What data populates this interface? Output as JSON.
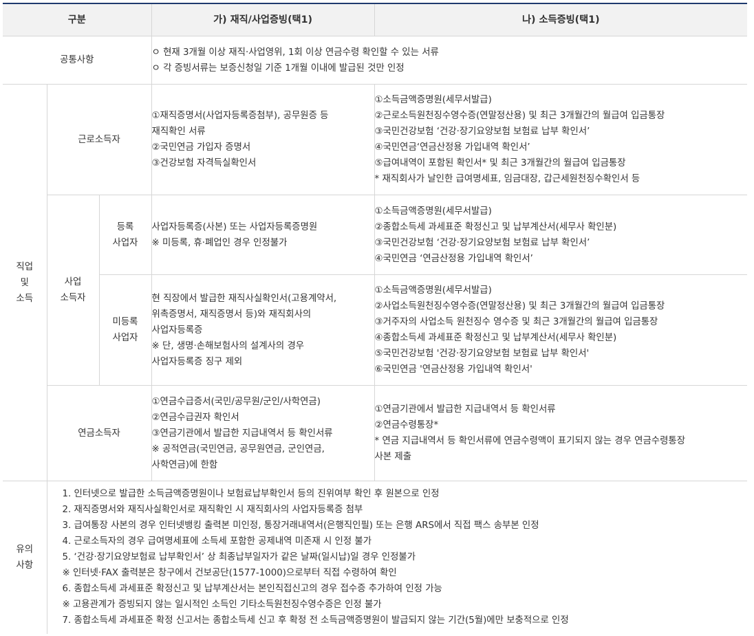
{
  "header": {
    "col_category": "구분",
    "col_employment": "가) 재직/사업증빙(택1)",
    "col_income": "나) 소득증빙(택1)"
  },
  "common": {
    "label": "공통사항",
    "lines": [
      "ㅇ 현재 3개월 이상 재직·사업영위, 1회 이상 연금수령 확인할 수 있는 서류",
      "ㅇ 각 증빙서류는 보증신청일 기준 1개월 이내에 발급된 것만 인정"
    ]
  },
  "job_income": {
    "label": [
      "직업",
      "및",
      "소득"
    ],
    "wage_earner": {
      "label": "근로소득자",
      "employment": [
        "①재직증명서(사업자등록증첨부), 공무원증 등",
        "재직확인 서류",
        "②국민연금 가입자 증명서",
        "③건강보험 자격득실확인서"
      ],
      "income": [
        "①소득금액증명원(세무서발급)",
        "②근로소득원천징수영수증(연말정산용) 및 최근 3개월간의 월급여 입금통장",
        "③국민건강보험 ‘건강·장기요양보험 보험료 납부 확인서’",
        "④국민연금‘연금산정용 가입내역 확인서’",
        "⑤급여내역이 포함된 확인서* 및 최근 3개월간의 월급여 입금통장",
        "* 재직회사가 날인한 급여명세표, 임금대장, 갑근세원천징수확인서 등"
      ]
    },
    "business": {
      "label": [
        "사업",
        "소득자"
      ],
      "registered": {
        "label": [
          "등록",
          "사업자"
        ],
        "employment": [
          "사업자등록증(사본) 또는 사업자등록증명원",
          "※ 미등록, 휴·폐업인 경우 인정불가"
        ],
        "income": [
          "①소득금액증명원(세무서발급)",
          "②종합소득세 과세표준 확정신고 및 납부계산서(세무사 확인분)",
          "③국민건강보험 ‘건강·장기요양보험 보험료 납부 확인서’",
          "④국민연금 ‘연금산정용 가입내역 확인서’"
        ]
      },
      "unregistered": {
        "label": [
          "미등록",
          "사업자"
        ],
        "employment": [
          "현 직장에서 발급한 재직사실확인서(고용계약서,",
          "위촉증명서, 재직증명서 등)와 재직회사의",
          "사업자등록증",
          "※ 단, 생명·손해보험사의 설계사의 경우",
          "사업자등록증 징구 제외"
        ],
        "income": [
          "①소득금액증명원(세무서발급)",
          "②사업소득원천징수영수증(연말정산용) 및 최근 3개월간의 월급여 입금통장",
          "③거주자의 사업소득 원천징수 영수증 및 최근 3개월간의 월급여 입금통장",
          "④종합소득세 과세표준 확정신고 및 납부계산서(세무사 확인분)",
          "⑤국민건강보험 '건강·장기요양보험 보험료 납부 확인서'",
          "⑥국민연금 '연금산정용 가입내역 확인서'"
        ]
      }
    },
    "pension": {
      "label": "연금소득자",
      "employment": [
        "①연금수급증서(국민/공무원/군인/사학연금)",
        "②연금수급권자 확인서",
        "③연금기관에서 발급한 지급내역서 등 확인서류",
        "※ 공적연금(국민연금, 공무원연금, 군인연금,",
        "사학연금)에 한함"
      ],
      "income": [
        "①연금기관에서 발급한 지급내역서 등 확인서류",
        "②연금수령통장*",
        "* 연금 지급내역서 등 확인서류에 연금수령액이 표기되지 않는 경우 연금수령통장",
        "사본 제출"
      ]
    }
  },
  "notes": {
    "label": [
      "유의",
      "사항"
    ],
    "items": [
      "1. 인터넷으로 발급한 소득금액증명원이나 보험료납부확인서 등의 진위여부 확인 후 원본으로 인정",
      "2. 재직증명서와 재직사실확인서로 재직확인 시 재직회사의 사업자등록증 첨부",
      "3. 급여통장 사본의 경우 인터넷뱅킹 출력본 미인정, 통장거래내역서(은행직인필) 또는 은행 ARS에서 직접 팩스 송부본 인정",
      "4. 근로소득자의 경우 급여명세표에 소득세 포함한 공제내역 미존재 시 인정 불가",
      "5. ‘건강·장기요양보험료 납부확인서’ 상 최종납부일자가 같은 날짜(일시납)일 경우 인정불가",
      "※ 인터넷·FAX 출력분은 창구에서 건보공단(1577-1000)으로부터 직접 수령하여 확인",
      "6. 종합소득세 과세표준 확정신고 및 납부계산서는 본인직접신고의 경우 접수증 추가하여 인정 가능",
      "※ 고용관계가 증빙되지 않는 일시적인 소득인 기타소득원천징수영수증은 인정 불가",
      "7. 종합소득세 과세표준 확정 신고서는 종합소득세 신고 후 확정 전 소득금액증명원이 발급되지 않는 기간(5월)에만 보충적으로 인정"
    ]
  }
}
